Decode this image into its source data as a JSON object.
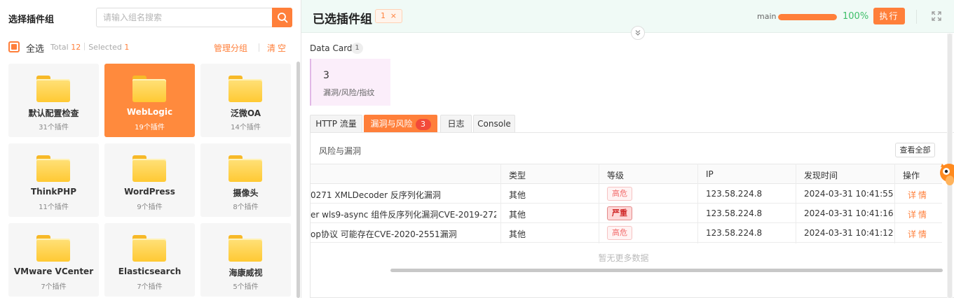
{
  "left": {
    "title": "选择插件组",
    "search_placeholder": "请输入组名搜索",
    "select_all": "全选",
    "total_label": "Total",
    "total": "12",
    "selected_label": "Selected",
    "selected": "1",
    "manage": "管理分组",
    "clear": "清空",
    "groups": [
      {
        "name": "默认配置检查",
        "count": "31个插件",
        "active": false
      },
      {
        "name": "WebLogic",
        "count": "19个插件",
        "active": true
      },
      {
        "name": "泛微OA",
        "count": "14个插件",
        "active": false
      },
      {
        "name": "ThinkPHP",
        "count": "11个插件",
        "active": false
      },
      {
        "name": "WordPress",
        "count": "9个插件",
        "active": false
      },
      {
        "name": "摄像头",
        "count": "8个插件",
        "active": false
      },
      {
        "name": "VMware VCenter",
        "count": "7个插件",
        "active": false
      },
      {
        "name": "Elasticsearch",
        "count": "7个插件",
        "active": false
      },
      {
        "name": "海康威视",
        "count": "5个插件",
        "active": false
      }
    ]
  },
  "right": {
    "title": "已选插件组",
    "tag_count": "1",
    "tag_close": "×",
    "branch": "main",
    "progress_pct": 100,
    "progress_text": "100%",
    "exec": "执行",
    "data_card_label": "Data Card",
    "data_card_count": "1",
    "card_value": "3",
    "card_label": "漏洞/风险/指纹",
    "tabs": [
      {
        "label": "HTTP 流量",
        "badge": null,
        "active": false
      },
      {
        "label": "漏洞与风险",
        "badge": "3",
        "active": true
      },
      {
        "label": "日志",
        "badge": null,
        "active": false
      },
      {
        "label": "Console",
        "badge": null,
        "active": false
      }
    ],
    "panel_title": "风险与漏洞",
    "view_all": "查看全部",
    "columns": [
      "类型",
      "等级",
      "IP",
      "发现时间",
      "操作"
    ],
    "rows": [
      {
        "title": "0271 XMLDecoder 反序列化漏洞",
        "type": "其他",
        "level": "高危",
        "severe": false,
        "ip": "123.58.224.8",
        "time": "2024-03-31 10:41:55",
        "action": "详情"
      },
      {
        "title": "er wls9-async 组件反序列化漏洞CVE-2019-272...",
        "type": "其他",
        "level": "严重",
        "severe": true,
        "ip": "123.58.224.8",
        "time": "2024-03-31 10:41:16",
        "action": "详情"
      },
      {
        "title": "op协议 可能存在CVE-2020-2551漏洞",
        "type": "其他",
        "level": "高危",
        "severe": false,
        "ip": "123.58.224.8",
        "time": "2024-03-31 10:41:12",
        "action": "详情"
      }
    ],
    "no_more": "暂无更多数据"
  }
}
